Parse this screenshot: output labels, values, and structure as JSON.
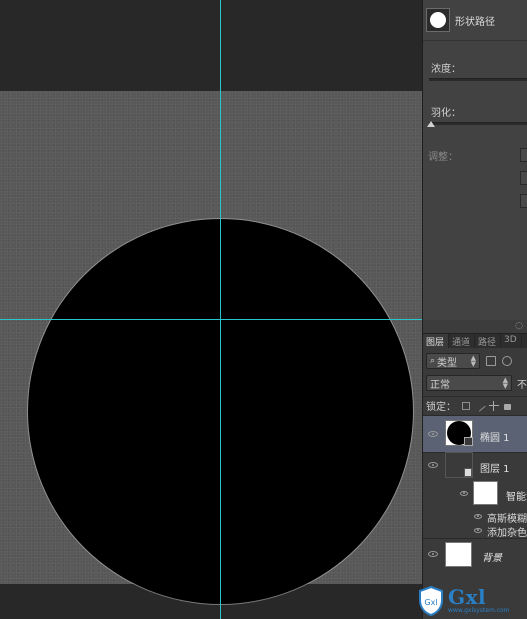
{
  "properties": {
    "title": "形状路径",
    "density_label": "浓度：",
    "feather_label": "羽化：",
    "adjust_label": "调整："
  },
  "layers_panel": {
    "tabs": [
      "图层",
      "通道",
      "路径",
      "3D"
    ],
    "filter_kind": "类型",
    "blend_mode": "正常",
    "opacity_label": "不",
    "lock_label": "锁定：",
    "layers": [
      {
        "name": "椭圆 1",
        "selected": true,
        "visible": true,
        "thumb": "black-circle"
      },
      {
        "name": "图层 1",
        "selected": false,
        "visible": true,
        "thumb": "smart-object"
      },
      {
        "name": "智能滤",
        "selected": false,
        "visible": true,
        "thumb": "white-mask"
      },
      {
        "name": "高斯模糊",
        "selected": false,
        "visible": true,
        "thumb": "none"
      },
      {
        "name": "添加杂色",
        "selected": false,
        "visible": true,
        "thumb": "none"
      },
      {
        "name": "背景",
        "selected": false,
        "visible": true,
        "thumb": "white"
      }
    ]
  },
  "watermark": {
    "brand": "Gxl",
    "domain_text": "www.gxlsystem.com"
  },
  "colors": {
    "guide": "#28c6cf",
    "selection": "#5a6273",
    "canvas_fill": "#000000"
  }
}
